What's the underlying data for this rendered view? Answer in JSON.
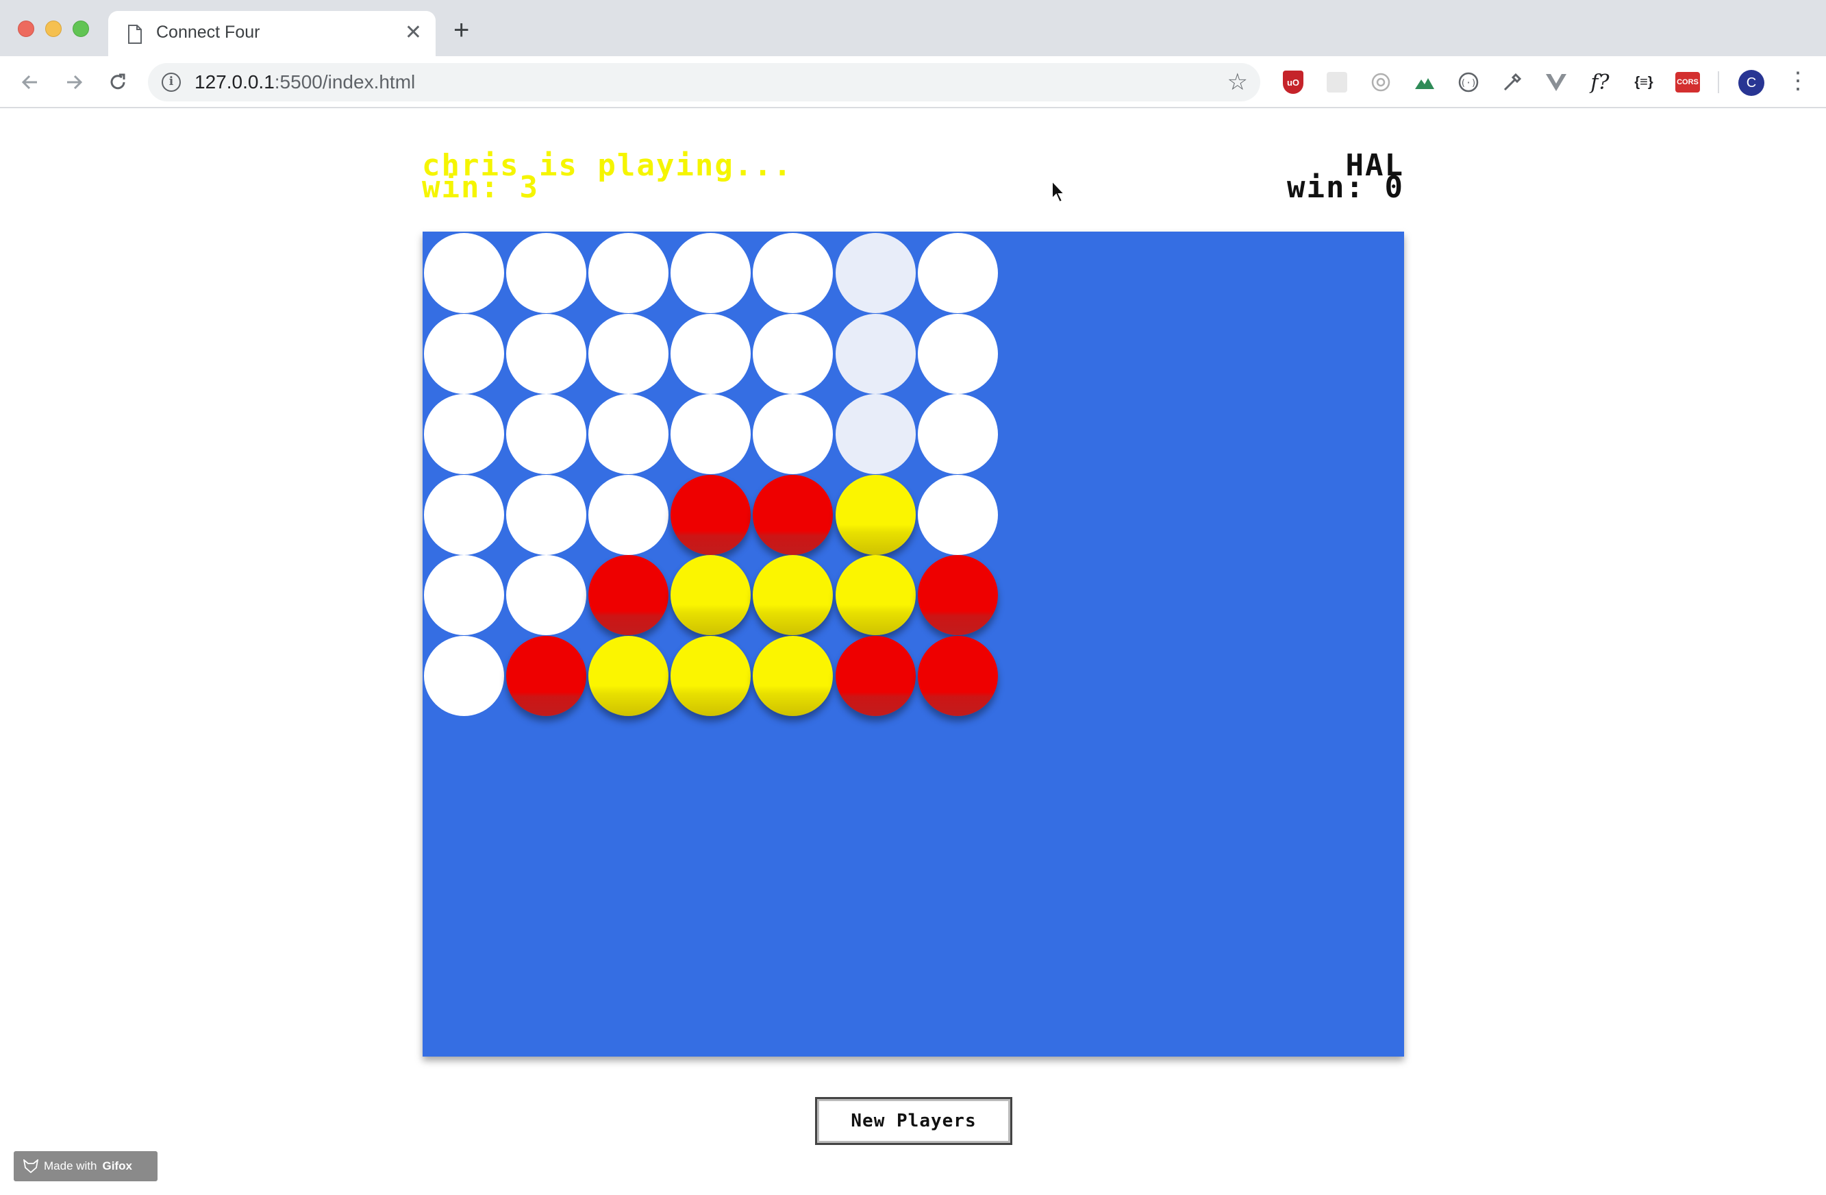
{
  "browser": {
    "tab_title": "Connect Four",
    "new_tab_label": "+",
    "close_label": "✕",
    "url_host": "127.0.0.1",
    "url_path": ":5500/index.html",
    "profile_initial": "C",
    "ext_ublock": "uO",
    "ext_font": "f?",
    "ext_json": "{≡}",
    "ext_cors": "CORS"
  },
  "game": {
    "player1_status": "chris is playing...",
    "player1_wins": "win: 3",
    "player2_name": "HAL",
    "player2_wins": "win: 0",
    "player1_color": "#f5f500",
    "player2_color": "#111111",
    "board_color": "#356ee3",
    "hover_column": 5,
    "grid": [
      [
        "empty",
        "empty",
        "empty",
        "empty",
        "empty",
        "hover",
        "empty"
      ],
      [
        "empty",
        "empty",
        "empty",
        "empty",
        "empty",
        "hover",
        "empty"
      ],
      [
        "empty",
        "empty",
        "empty",
        "empty",
        "empty",
        "hover",
        "empty"
      ],
      [
        "empty",
        "empty",
        "empty",
        "red",
        "red",
        "yellow",
        "empty"
      ],
      [
        "empty",
        "empty",
        "red",
        "yellow",
        "yellow",
        "yellow",
        "red"
      ],
      [
        "empty",
        "red",
        "yellow",
        "yellow",
        "yellow",
        "red",
        "red"
      ]
    ],
    "new_players_label": "New Players"
  },
  "watermark": {
    "prefix": "Made with",
    "brand": "Gifox"
  }
}
